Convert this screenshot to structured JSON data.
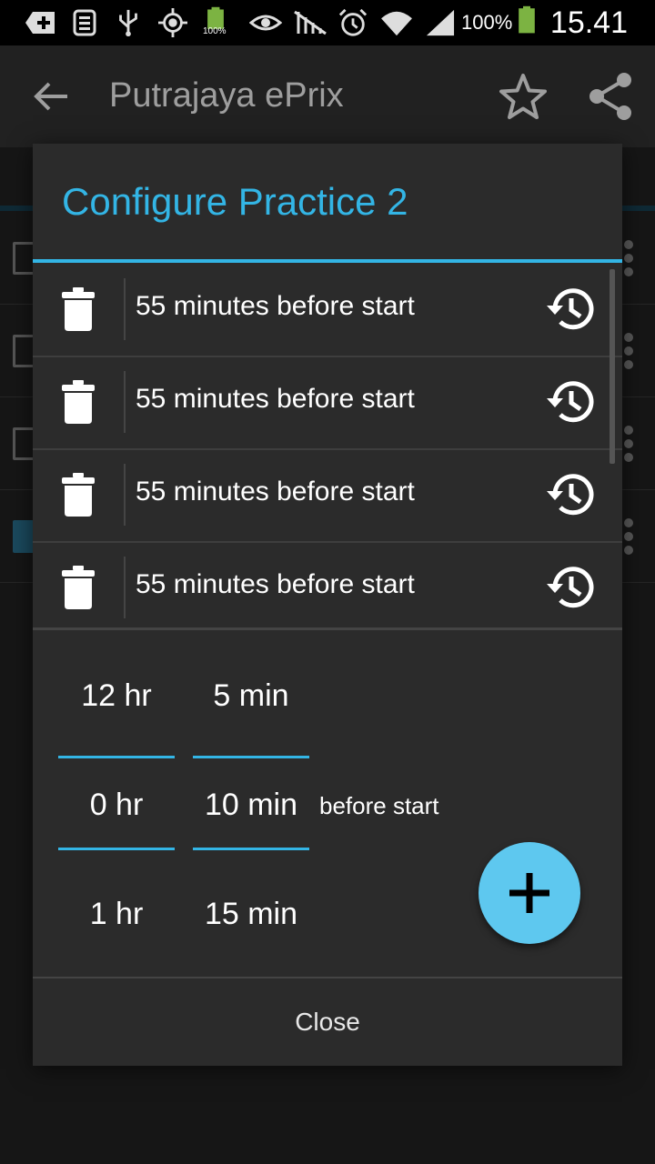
{
  "status_bar": {
    "battery_percent": "100%",
    "small_battery_label": "100%",
    "time": "15.41",
    "icons": [
      "add-icon",
      "sim-card-icon",
      "usb-icon",
      "gps-icon",
      "battery-small-icon",
      "eye-icon",
      "no-signal-icon",
      "alarm-icon",
      "wifi-icon",
      "cell-signal-icon",
      "battery-icon"
    ]
  },
  "app_bar": {
    "title": "Putrajaya ePrix",
    "icons": [
      "back-arrow-icon",
      "star-icon",
      "share-icon"
    ]
  },
  "dialog": {
    "title": "Configure Practice 2",
    "reminders": [
      {
        "label": "55 minutes before start"
      },
      {
        "label": "55 minutes before start"
      },
      {
        "label": "55 minutes before start"
      },
      {
        "label": "55 minutes before start"
      }
    ],
    "hour_picker": {
      "above": "12 hr",
      "selected": "0 hr",
      "below": "1 hr"
    },
    "minute_picker": {
      "above": "5 min",
      "selected": "10 min",
      "below": "15 min"
    },
    "suffix_label": "before start",
    "add_icon": "plus-icon",
    "close_label": "Close"
  },
  "colors": {
    "accent": "#33b5e5",
    "fab": "#5ec8ef",
    "dialog_bg": "#2b2b2b",
    "appbar_bg": "#212121"
  }
}
